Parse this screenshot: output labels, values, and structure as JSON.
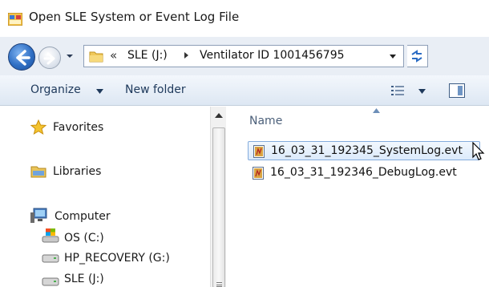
{
  "window": {
    "title": "Open SLE System or Event Log File",
    "icon": "app-window-icon"
  },
  "address_bar": {
    "overflow_chevron": "«",
    "crumbs": [
      "SLE (J:)",
      "Ventilator ID 1001456795"
    ]
  },
  "toolbar": {
    "organize_label": "Organize",
    "new_folder_label": "New folder"
  },
  "nav_pane": {
    "favorites": "Favorites",
    "libraries": "Libraries",
    "computer": "Computer",
    "drives": [
      "OS (C:)",
      "HP_RECOVERY (G:)",
      "SLE (J:)"
    ]
  },
  "file_list": {
    "column_name": "Name",
    "files": [
      {
        "name": "16_03_31_192345_SystemLog.evt",
        "selected": true
      },
      {
        "name": "16_03_31_192346_DebugLog.evt",
        "selected": false
      }
    ]
  },
  "colors": {
    "accent": "#2f6fc4",
    "toolbar_text": "#1e395b",
    "selection_border": "#84acdd",
    "address_bg": "#e9eef5"
  }
}
